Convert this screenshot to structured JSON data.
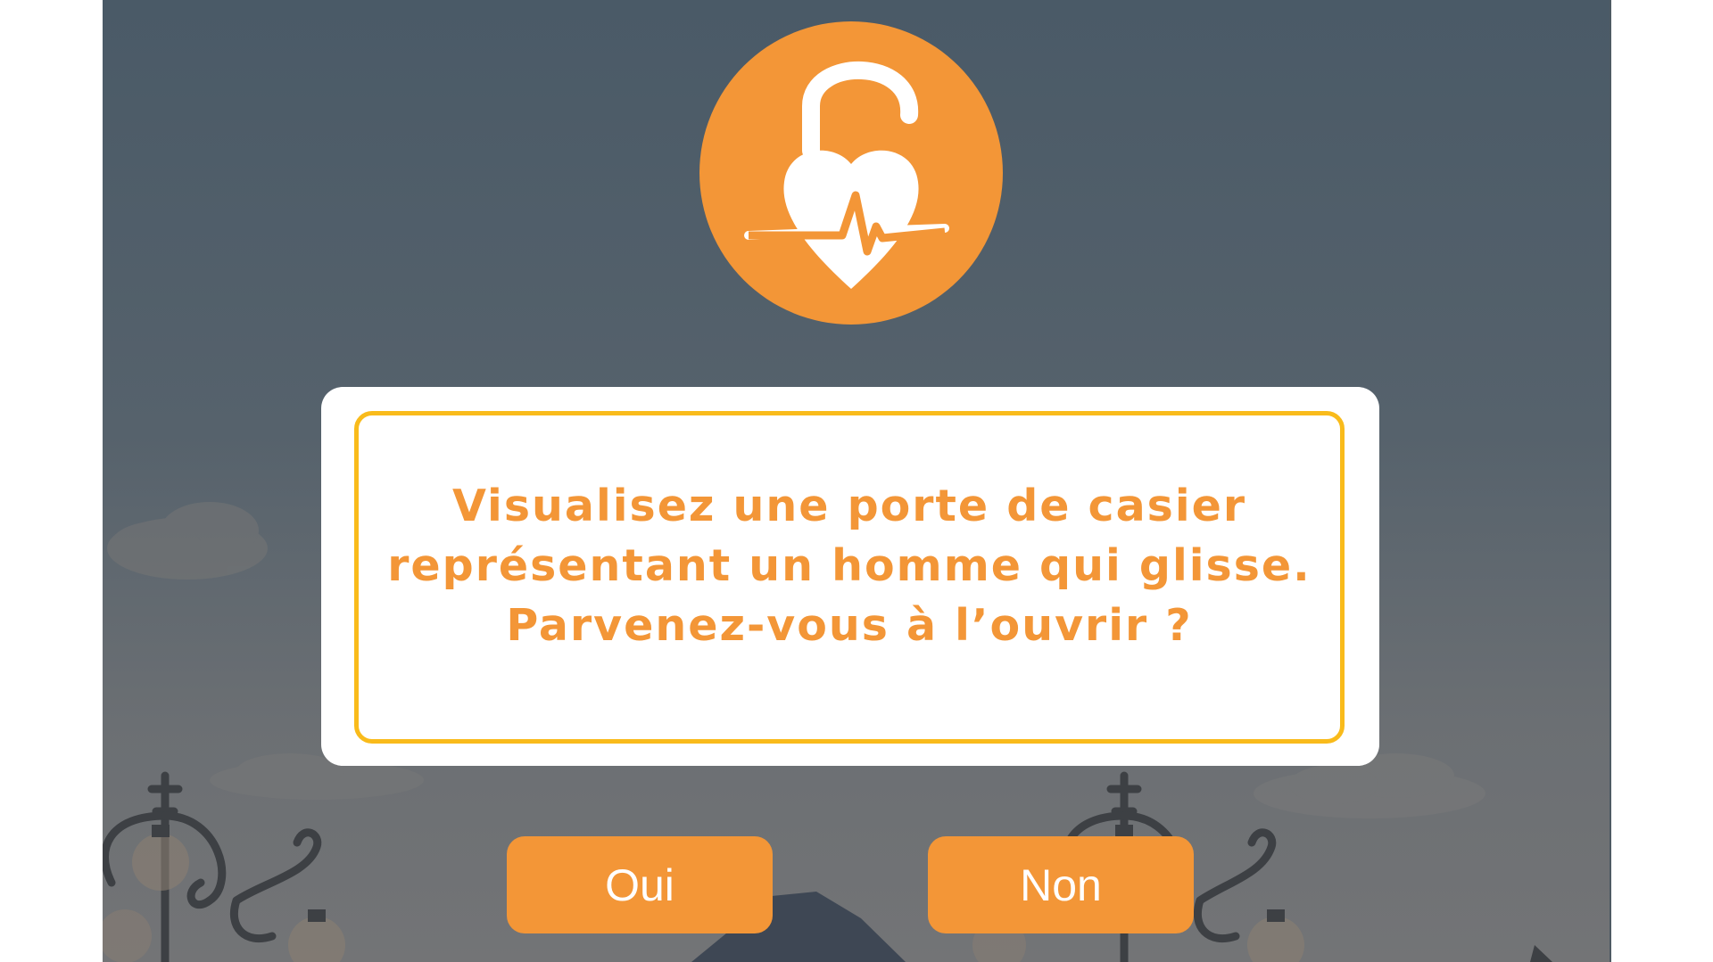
{
  "dialog": {
    "message": "Visualisez une porte de casier représentant un homme qui glisse. Parvenez-vous à l’ouvrir ?"
  },
  "buttons": {
    "yes_label": "Oui",
    "no_label": "Non"
  },
  "icons": {
    "logo": "unlocked-heart-heartbeat-icon"
  },
  "colors": {
    "accent": "#f39637",
    "frame": "#f9bb1b",
    "background_top": "#4a5a67",
    "background_bottom": "#737476",
    "dialog_bg": "#ffffff",
    "button_text": "#ffffff"
  }
}
